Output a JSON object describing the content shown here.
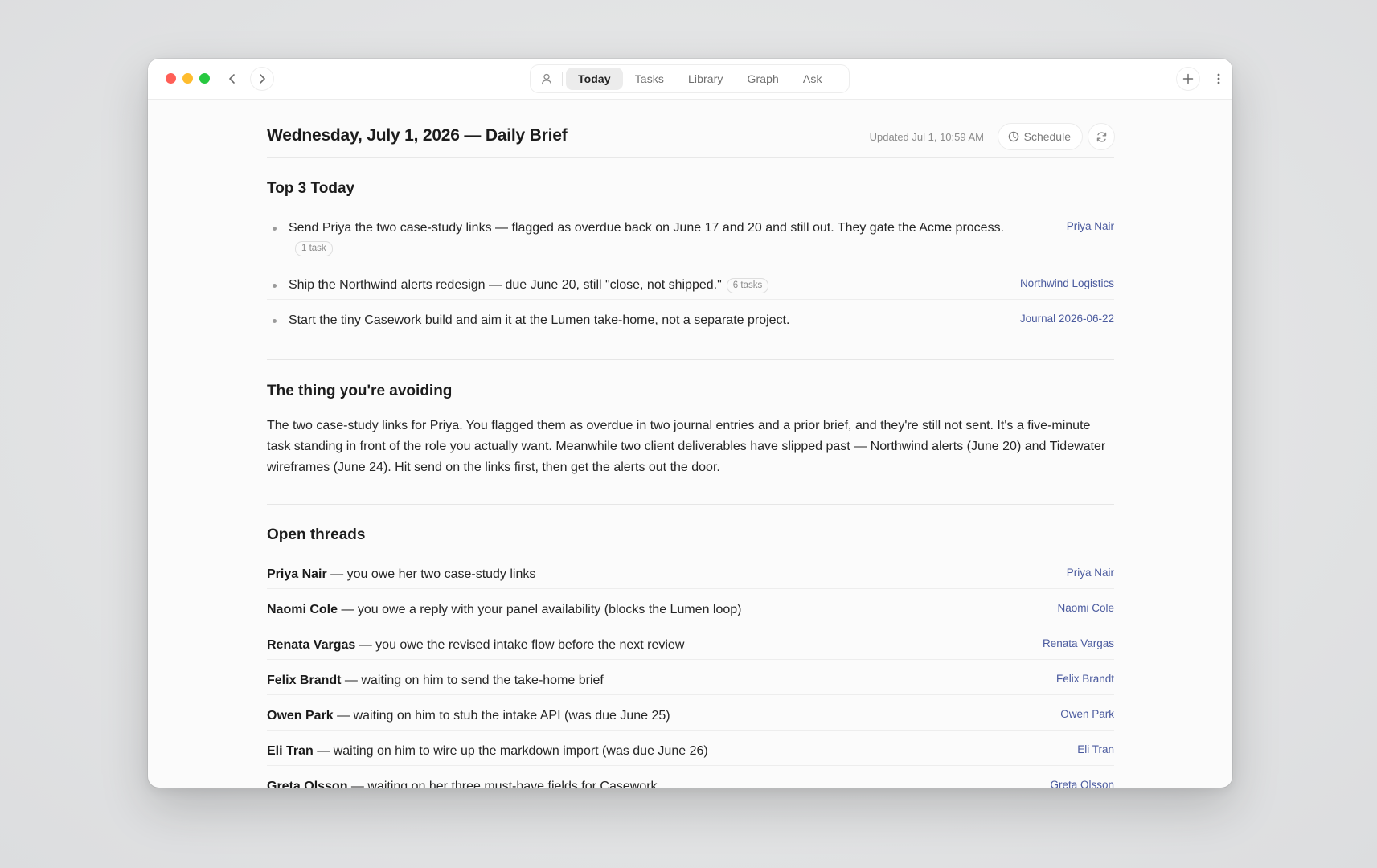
{
  "tabs": [
    "Today",
    "Tasks",
    "Library",
    "Graph",
    "Ask"
  ],
  "active_tab": "Today",
  "header": {
    "title": "Wednesday, July 1, 2026 — Daily Brief",
    "updated": "Updated Jul 1, 10:59 AM",
    "schedule_label": "Schedule"
  },
  "top3": {
    "title": "Top 3 Today",
    "items": [
      {
        "text": "Send Priya the two case-study links — flagged as overdue back on June 17 and 20 and still out. They gate the Acme process.",
        "badge": "1 task",
        "link": "Priya Nair"
      },
      {
        "text": "Ship the Northwind alerts redesign — due June 20, still \"close, not shipped.\"",
        "badge": "6 tasks",
        "link": "Northwind Logistics"
      },
      {
        "text": "Start the tiny Casework build and aim it at the Lumen take-home, not a separate project.",
        "badge": "",
        "link": "Journal 2026-06-22"
      }
    ]
  },
  "avoiding": {
    "title": "The thing you're avoiding",
    "body": "The two case-study links for Priya. You flagged them as overdue in two journal entries and a prior brief, and they're still not sent. It's a five-minute task standing in front of the role you actually want. Meanwhile two client deliverables have slipped past — Northwind alerts (June 20) and Tidewater wireframes (June 24). Hit send on the links first, then get the alerts out the door."
  },
  "threads": {
    "title": "Open threads",
    "items": [
      {
        "name": "Priya Nair",
        "text": " — you owe her two case-study links",
        "link": "Priya Nair"
      },
      {
        "name": "Naomi Cole",
        "text": " — you owe a reply with your panel availability (blocks the Lumen loop)",
        "link": "Naomi Cole"
      },
      {
        "name": "Renata Vargas",
        "text": " — you owe the revised intake flow before the next review",
        "link": "Renata Vargas"
      },
      {
        "name": "Felix Brandt",
        "text": " — waiting on him to send the take-home brief",
        "link": "Felix Brandt"
      },
      {
        "name": "Owen Park",
        "text": " — waiting on him to stub the intake API (was due June 25)",
        "link": "Owen Park"
      },
      {
        "name": "Eli Tran",
        "text": " — waiting on him to wire up the markdown import (was due June 26)",
        "link": "Eli Tran"
      },
      {
        "name": "Greta Olsson",
        "text": " — waiting on her three must-have fields for Casework",
        "link": "Greta Olsson"
      }
    ]
  },
  "icons": {
    "close": "close-dot",
    "minimize": "minimize-dot",
    "zoom": "zoom-dot",
    "back": "chevron-left-icon",
    "forward": "chevron-right-icon",
    "user": "user-icon",
    "add": "plus-icon",
    "more": "more-vertical-icon",
    "schedule": "clock-icon",
    "refresh": "refresh-icon"
  },
  "colors": {
    "link": "#4a5a9e",
    "close": "#ff5f57",
    "minimize": "#febc2e",
    "zoom": "#28c840"
  }
}
